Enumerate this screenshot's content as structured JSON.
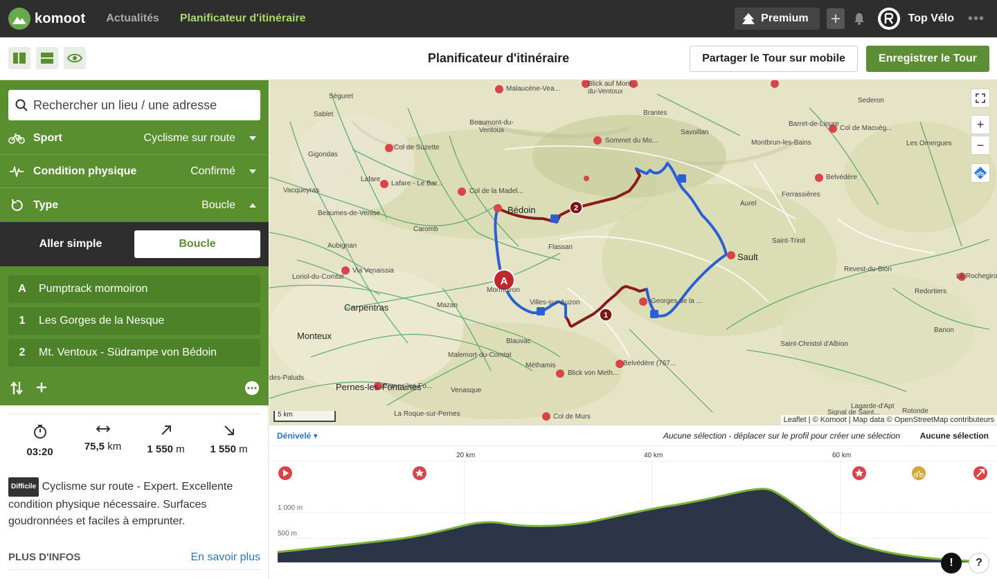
{
  "nav": {
    "logo_text": "komoot",
    "links": [
      {
        "label": "Actualités",
        "active": false
      },
      {
        "label": "Planificateur d'itinéraire",
        "active": true
      }
    ],
    "premium_label": "Premium",
    "username": "Top Vélo",
    "more": "•••"
  },
  "toolbar": {
    "title": "Planificateur d'itinéraire",
    "share_label": "Partager le Tour sur mobile",
    "save_label": "Enregistrer le Tour"
  },
  "planner": {
    "search_placeholder": "Rechercher un lieu / une adresse",
    "options": [
      {
        "icon": "bike-icon",
        "label": "Sport",
        "value": "Cyclisme sur route",
        "caret": "down"
      },
      {
        "icon": "pulse-icon",
        "label": "Condition physique",
        "value": "Confirmé",
        "caret": "down"
      },
      {
        "icon": "loop-icon",
        "label": "Type",
        "value": "Boucle",
        "caret": "up"
      }
    ],
    "type_switch": {
      "left": "Aller simple",
      "right": "Boucle"
    },
    "waypoints": [
      {
        "key": "A",
        "name": "Pumptrack mormoiron"
      },
      {
        "key": "1",
        "name": "Les Gorges de la Nesque"
      },
      {
        "key": "2",
        "name": "Mt. Ventoux - Südrampe von Bédoin"
      }
    ]
  },
  "stats": {
    "duration": "03:20",
    "distance_value": "75,5",
    "distance_unit": "km",
    "up_value": "1 550",
    "up_unit": "m",
    "down_value": "1 550",
    "down_unit": "m"
  },
  "difficulty": {
    "badge": "Difficile",
    "text": "Cyclisme sur route - Expert. Excellente condition physique nécessaire. Surfaces goudronnées et faciles à emprunter."
  },
  "more_info": {
    "title": "PLUS D'INFOS",
    "link": "En savoir plus"
  },
  "map": {
    "labels": [
      {
        "t": "Séguret",
        "big": false
      },
      {
        "t": "Sablet",
        "big": false
      },
      {
        "t": "Gigondas",
        "big": false
      },
      {
        "t": "Vacqueyras",
        "big": false
      },
      {
        "t": "Lafare",
        "big": false
      },
      {
        "t": "Beaumont-du-Ventoux",
        "big": false
      },
      {
        "t": "Malaucène-Vea...",
        "big": false
      },
      {
        "t": "Blick auf Mont ... du-Ventoux",
        "big": false
      },
      {
        "t": "Brantes",
        "big": false
      },
      {
        "t": "Savoillan",
        "big": false
      },
      {
        "t": "Sommet du Mo...",
        "big": false
      },
      {
        "t": "Col de Suzette",
        "big": false
      },
      {
        "t": "Lafare - Le Bar...",
        "big": false
      },
      {
        "t": "Col de la Madel...",
        "big": false
      },
      {
        "t": "Beaumes-de-Venise",
        "big": false
      },
      {
        "t": "Bédoin",
        "big": true
      },
      {
        "t": "Caromb",
        "big": false
      },
      {
        "t": "Aubignan",
        "big": false
      },
      {
        "t": "Flassan",
        "big": false
      },
      {
        "t": "Via Venaissia",
        "big": false
      },
      {
        "t": "Loriol-du-Comtat",
        "big": false
      },
      {
        "t": "Carpentras",
        "big": true
      },
      {
        "t": "Mazan",
        "big": false
      },
      {
        "t": "Mormoiron",
        "big": false
      },
      {
        "t": "Villes-sur-Auzon",
        "big": false
      },
      {
        "t": "Georges de la ...",
        "big": false
      },
      {
        "t": "Monteux",
        "big": true
      },
      {
        "t": "Blauvac",
        "big": false
      },
      {
        "t": "Malemort-du-Comtat",
        "big": false
      },
      {
        "t": "Méthamis",
        "big": false
      },
      {
        "t": "Blick von Meth...",
        "big": false
      },
      {
        "t": "Belvédère (767...",
        "big": false
      },
      {
        "t": "Pernes-les-Fontaines",
        "big": true
      },
      {
        "t": "Pernes-les-Fo...",
        "big": false
      },
      {
        "t": "Venasque",
        "big": false
      },
      {
        "t": "La Roque-sur-Pernes",
        "big": false
      },
      {
        "t": "Col de Murs",
        "big": false
      },
      {
        "t": "des-Paluds",
        "big": false
      },
      {
        "t": "Sault",
        "big": true
      },
      {
        "t": "Aurel",
        "big": false
      },
      {
        "t": "Saint-Trinit",
        "big": false
      },
      {
        "t": "Ferrassières",
        "big": false
      },
      {
        "t": "Montbrun-les-Bains",
        "big": false
      },
      {
        "t": "Barret-de-Lioure",
        "big": false
      },
      {
        "t": "Col de Macuèg...",
        "big": false
      },
      {
        "t": "Sederon",
        "big": false
      },
      {
        "t": "Les Omergues",
        "big": false
      },
      {
        "t": "Belvédère",
        "big": false
      },
      {
        "t": "Revest-du-Bion",
        "big": false
      },
      {
        "t": "La Rochegiron",
        "big": false
      },
      {
        "t": "Redortiers",
        "big": false
      },
      {
        "t": "Saint-Christol d'Albion",
        "big": false
      },
      {
        "t": "Banon",
        "big": false
      },
      {
        "t": "Lagarde-d'Apt",
        "big": false
      },
      {
        "t": "Signal de Saint...",
        "big": false
      },
      {
        "t": "Rotonde",
        "big": false
      }
    ],
    "scale": "5 km",
    "attribution": "Leaflet | © Komoot | Map data © OpenStreetMap contributeurs",
    "zoom_in": "+",
    "zoom_out": "−",
    "marker_start": "A",
    "marker_1": "1",
    "marker_2": "2"
  },
  "elevation": {
    "selector_label": "Dénivelé",
    "hint": "Aucune sélection - déplacer sur le profil pour créer une sélection",
    "no_selection": "Aucune sélection",
    "km_ticks": [
      "20 km",
      "40 km",
      "60 km"
    ],
    "alt_ticks": [
      "1 000 m",
      "500 m"
    ],
    "report_btn": "!",
    "help_btn": "?"
  },
  "colors": {
    "brand_green": "#5a8f2f",
    "route_blue": "#2b5fd6",
    "route_red": "#8b1a1a",
    "nav_bg": "#2e2e2e"
  }
}
